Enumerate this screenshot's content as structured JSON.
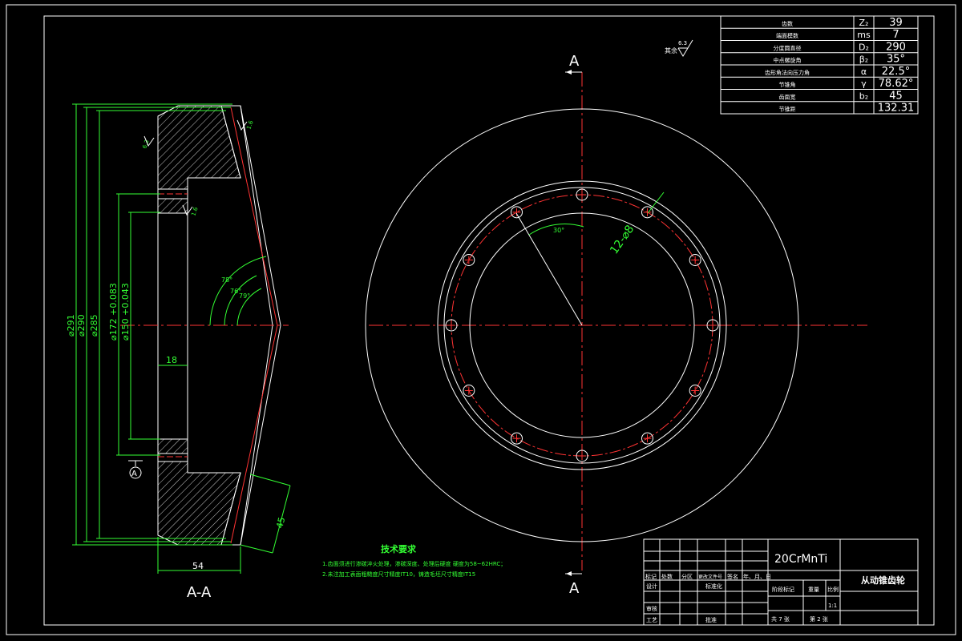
{
  "param_table": [
    {
      "label": "齿数",
      "symbol": "Z₂",
      "value": "39"
    },
    {
      "label": "端面模数",
      "symbol": "ms",
      "value": "7"
    },
    {
      "label": "分度圆直径",
      "symbol": "D₂",
      "value": "290"
    },
    {
      "label": "中点螺旋角",
      "symbol": "β₂",
      "value": "35°"
    },
    {
      "label": "齿形角法向压力角",
      "symbol": "α",
      "value": "22.5°"
    },
    {
      "label": "节锥角",
      "symbol": "γ",
      "value": "78.62°"
    },
    {
      "label": "齿面宽",
      "symbol": "b₂",
      "value": "45"
    },
    {
      "label": "节锥距",
      "symbol": "",
      "value": "132.31"
    }
  ],
  "roughness": {
    "prefix": "其余",
    "value": "6.3"
  },
  "section_markers": {
    "top": "A",
    "bottom": "A",
    "view_label": "A-A",
    "datum": "A"
  },
  "dims": {
    "d291": "⌀291",
    "d290": "⌀290",
    "d285": "⌀285",
    "d172": "⌀172 +0.083",
    "d150": "⌀150 +0.043",
    "w18": "18",
    "w54": "54",
    "w45": "45",
    "ang78": "78°",
    "ang76": "76°",
    "ang79": "79°",
    "holes": "12-⌀8",
    "ang30": "30°",
    "r_a": "6.3",
    "r_b": "1.6",
    "r_c": "1.6"
  },
  "tech": {
    "title": "技术要求",
    "line1": "1.齿面须进行渗碳淬火处理，渗碳深度、处理后硬度 硬度为58~62HRC；",
    "line2": "2.未注加工表面粗糙度尺寸精度IT10，铸造毛坯尺寸精度IT15"
  },
  "title_block": {
    "material": "20CrMnTi",
    "part_name": "从动锥齿轮",
    "scale_label": "比例",
    "scale_value": "1:1",
    "stage_label": "阶段标记",
    "weight_label": "重量",
    "row_marks": [
      "标记",
      "处数",
      "分区",
      "更改文件号",
      "签名",
      "年、月、日"
    ],
    "designer": "设计",
    "std": "标准化",
    "review": "审核",
    "process": "工艺",
    "approve": "批准",
    "sheets": "共 7 张",
    "sheet_no": "第 2 张"
  }
}
